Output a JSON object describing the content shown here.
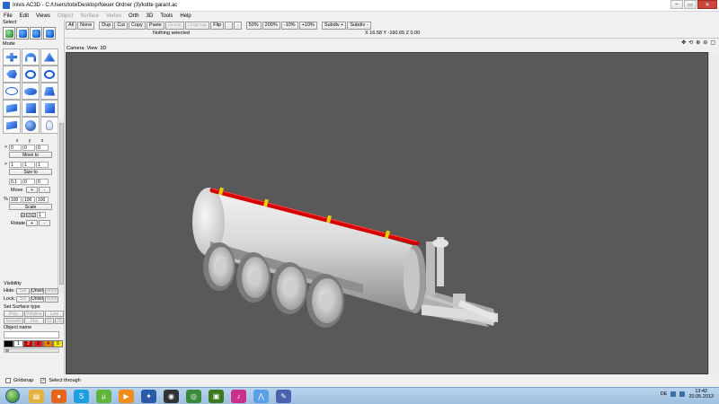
{
  "window": {
    "title": "Inivis AC3D - C:/Users/tobi/Desktop/Neuer Ordner (3)/kotte garant.ac",
    "minimize": "–",
    "maximize": "▭",
    "close": "✕"
  },
  "menu": [
    {
      "label": "File",
      "enabled": true
    },
    {
      "label": "Edit",
      "enabled": true
    },
    {
      "label": "Views",
      "enabled": true
    },
    {
      "label": "Object",
      "enabled": false
    },
    {
      "label": "Surface",
      "enabled": false
    },
    {
      "label": "Vertex",
      "enabled": false
    },
    {
      "label": "Orth",
      "enabled": true
    },
    {
      "label": "3D",
      "enabled": true
    },
    {
      "label": "Tools",
      "enabled": true
    },
    {
      "label": "Help",
      "enabled": true
    }
  ],
  "left": {
    "select_title": "Select",
    "mode_title": "Mode",
    "xyz": [
      "x",
      "y",
      "z"
    ],
    "move_values": [
      "0",
      "0",
      "0"
    ],
    "move_prefix": ">",
    "move_to": "Move to",
    "size_values": [
      "1",
      "1",
      "1"
    ],
    "size_prefix": ">",
    "size_to": "Size to",
    "move_step": [
      "0.1",
      "0",
      "0"
    ],
    "move_label": "Move",
    "plus": "+",
    "minus": "-",
    "scale_prefix": "%",
    "scale_values": [
      "100",
      "100",
      "100"
    ],
    "scale_label": "Scale",
    "rotate_checks": [
      "X",
      "Y",
      "Z"
    ],
    "rotate_value": "1",
    "rotate_label": "Rotate",
    "visibility_title": "Visibility",
    "hide_label": "Hide:",
    "lock_label": "Lock:",
    "sel": "Sel",
    "unsel": "Unsel",
    "none": "None",
    "surface_title": "Set Surface type",
    "surface_buttons": [
      "Poly",
      "Polyline",
      "Line",
      "Smooth",
      "Flat",
      "S1",
      "2S"
    ],
    "object_name_title": "Object name",
    "palette": [
      {
        "label": "",
        "color": "#000000"
      },
      {
        "label": "1",
        "color": "#ffffff"
      },
      {
        "label": "2",
        "color": "#c00000"
      },
      {
        "label": "3",
        "color": "#e02020"
      },
      {
        "label": "4",
        "color": "#f07a00"
      },
      {
        "label": "5",
        "color": "#f5e800"
      }
    ]
  },
  "toolbar": {
    "buttons": [
      {
        "label": "All",
        "enabled": true
      },
      {
        "label": "None",
        "enabled": true
      },
      {
        "gap": true
      },
      {
        "label": "Dup",
        "enabled": true
      },
      {
        "label": "Cut",
        "enabled": true
      },
      {
        "label": "Copy",
        "enabled": true
      },
      {
        "label": "Paste",
        "enabled": true
      },
      {
        "label": "Group",
        "enabled": false
      },
      {
        "label": "Ungroup",
        "enabled": false
      },
      {
        "label": "Flip",
        "enabled": true
      },
      {
        "label": "↑",
        "enabled": false
      },
      {
        "label": "↓",
        "enabled": false
      },
      {
        "gap": true
      },
      {
        "label": "50%",
        "enabled": true
      },
      {
        "label": "200%",
        "enabled": true
      },
      {
        "label": "-10%",
        "enabled": true
      },
      {
        "label": "+10%",
        "enabled": true
      },
      {
        "gap": true
      },
      {
        "label": "Subdiv +",
        "enabled": true
      },
      {
        "label": "Subdiv -",
        "enabled": true
      }
    ],
    "status": "Nothing selected",
    "coords": "X 16.58 Y -160.65 Z 0.00"
  },
  "viewport": {
    "tabs": [
      "Camera",
      "View",
      "3D"
    ],
    "header_icons": [
      "move-arrows-icon",
      "rotate-icon",
      "zoom-in-icon",
      "zoom-out-icon",
      "maximize-icon"
    ],
    "background": "#595959"
  },
  "bottom": {
    "gridsnap": "Gridsnap",
    "select_through": "Select through",
    "select_through_checked": true
  },
  "taskbar": {
    "apps": [
      {
        "name": "explorer-icon",
        "color": "#e3b13c",
        "glyph": "▤"
      },
      {
        "name": "firefox-icon",
        "color": "#e8661b",
        "glyph": "●"
      },
      {
        "name": "skype-icon",
        "color": "#1d9ee0",
        "glyph": "S"
      },
      {
        "name": "utorrent-icon",
        "color": "#5fb53a",
        "glyph": "µ"
      },
      {
        "name": "media-player-icon",
        "color": "#f08c1a",
        "glyph": "▶"
      },
      {
        "name": "game-icon",
        "color": "#2a5aa8",
        "glyph": "✦"
      },
      {
        "name": "recorder-icon",
        "color": "#333333",
        "glyph": "◉"
      },
      {
        "name": "chrome-icon",
        "color": "#3b8a3b",
        "glyph": "◎"
      },
      {
        "name": "nvidia-icon",
        "color": "#3c7a1c",
        "glyph": "▣"
      },
      {
        "name": "itunes-icon",
        "color": "#c8308a",
        "glyph": "♪"
      },
      {
        "name": "ac3d-icon",
        "color": "#5aa0e8",
        "glyph": "⋀"
      },
      {
        "name": "editor-icon",
        "color": "#4a62b0",
        "glyph": "✎"
      }
    ],
    "language": "DE",
    "time": "13:42",
    "date": "20.05.2013"
  }
}
